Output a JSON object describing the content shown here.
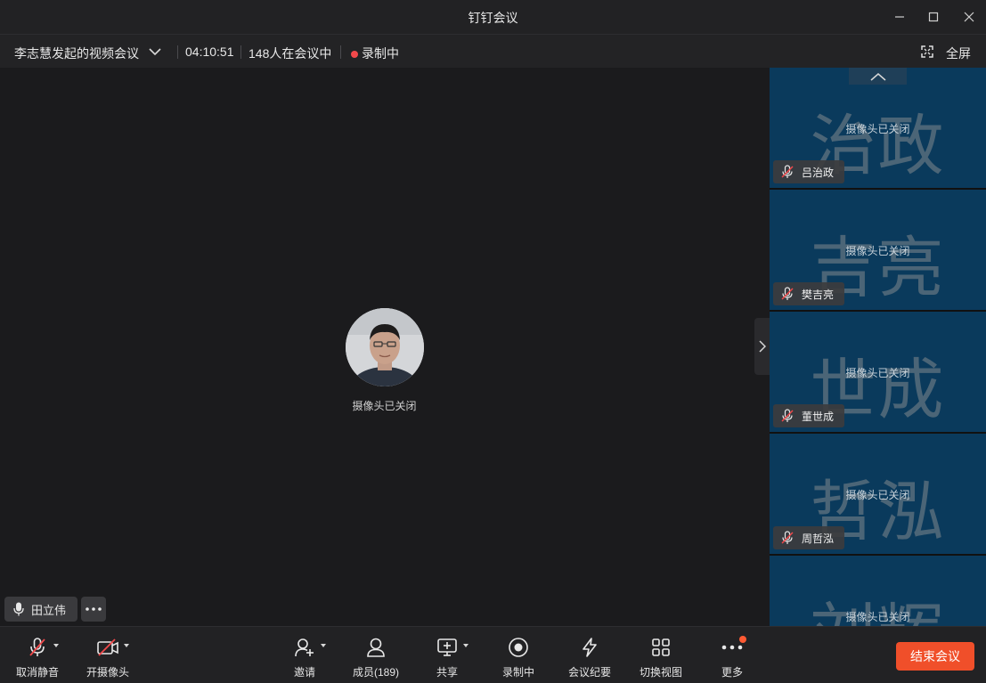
{
  "window": {
    "title": "钉钉会议"
  },
  "infobar": {
    "meeting_name": "李志慧发起的视频会议",
    "duration": "04:10:51",
    "participants_in_meeting": "148人在会议中",
    "recording_status": "录制中",
    "fullscreen_label": "全屏"
  },
  "stage": {
    "camera_status": "摄像头已关闭",
    "speaker_name": "田立伟"
  },
  "tiles": [
    {
      "big": "治政",
      "camera_status": "摄像头已关闭",
      "name": "吕治政"
    },
    {
      "big": "吉亮",
      "camera_status": "摄像头已关闭",
      "name": "樊吉亮"
    },
    {
      "big": "世成",
      "camera_status": "摄像头已关闭",
      "name": "董世成"
    },
    {
      "big": "哲泓",
      "camera_status": "摄像头已关闭",
      "name": "周哲泓"
    },
    {
      "big": "刘辉",
      "camera_status": "摄像头已关闭",
      "name": ""
    }
  ],
  "toolbar": {
    "unmute": "取消静音",
    "camera_on": "开摄像头",
    "invite": "邀请",
    "members": "成员(189)",
    "share": "共享",
    "recording": "录制中",
    "minutes": "会议纪要",
    "switch_view": "切换视图",
    "more": "更多",
    "end_meeting": "结束会议"
  },
  "colors": {
    "accent_end": "#f04f2a",
    "recording_dot": "#f2494b",
    "tile_bg": "#0a3a5c"
  }
}
